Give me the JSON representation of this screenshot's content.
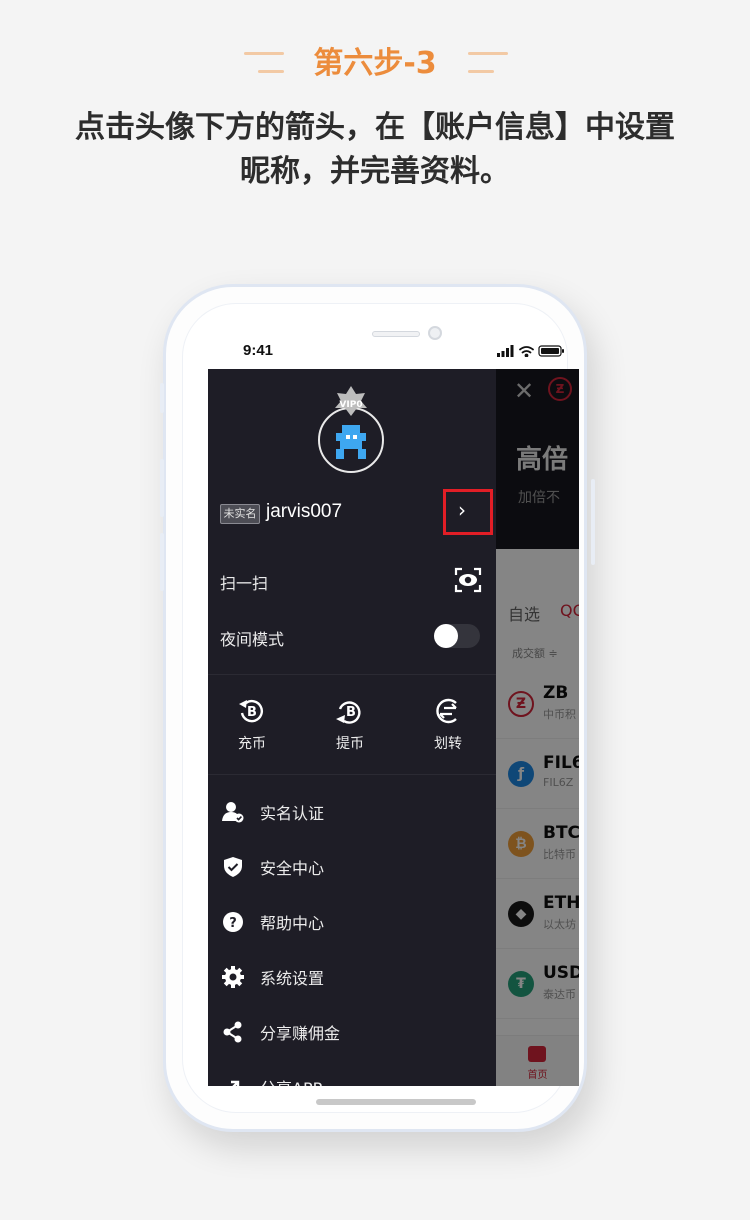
{
  "step": {
    "title": "第六步-3"
  },
  "instructions": {
    "line1": "点击头像下方的箭头，在【账户信息】中设置",
    "line2": "昵称，并完善资料。"
  },
  "status_bar": {
    "time": "9:41"
  },
  "drawer": {
    "vip_label": "VIP0",
    "verify_tag": "未实名",
    "username": "jarvis007",
    "arrow": "›",
    "scan_label": "扫一扫",
    "night_mode_label": "夜间模式",
    "actions": [
      {
        "label": "充币",
        "icon": "deposit-icon"
      },
      {
        "label": "提币",
        "icon": "withdraw-icon"
      },
      {
        "label": "划转",
        "icon": "transfer-icon"
      }
    ],
    "menu": [
      {
        "label": "实名认证",
        "icon": "id-verify-icon"
      },
      {
        "label": "安全中心",
        "icon": "shield-icon"
      },
      {
        "label": "帮助中心",
        "icon": "help-icon"
      },
      {
        "label": "系统设置",
        "icon": "gear-icon"
      },
      {
        "label": "分享赚佣金",
        "icon": "share-icon"
      },
      {
        "label": "分享APP",
        "icon": "share-app-icon"
      }
    ]
  },
  "app": {
    "hero_title": "高倍",
    "hero_subtitle": "加倍不",
    "tabs": [
      "自选",
      "QC"
    ],
    "sort_label": "成交额 ≑",
    "coins": [
      {
        "symbol": "ZB",
        "name": "中币积",
        "color": "#ffffff",
        "icon": "zb-icon"
      },
      {
        "symbol": "FIL6",
        "name": "FIL6Z",
        "color": "#1e88e5",
        "icon": "fil-icon"
      },
      {
        "symbol": "BTC",
        "name": "比特币",
        "color": "#f2a03a",
        "icon": "btc-icon"
      },
      {
        "symbol": "ETH",
        "name": "以太坊",
        "color": "#1a1a1a",
        "icon": "eth-icon"
      },
      {
        "symbol": "USD",
        "name": "泰达币",
        "color": "#26a17b",
        "icon": "usdt-icon"
      }
    ],
    "nav_home": "首页"
  },
  "colors": {
    "accent": "#ec8c3c",
    "highlight": "#e21e26",
    "drawer_bg": "#1e1d26",
    "brand_red": "#d5263a"
  }
}
